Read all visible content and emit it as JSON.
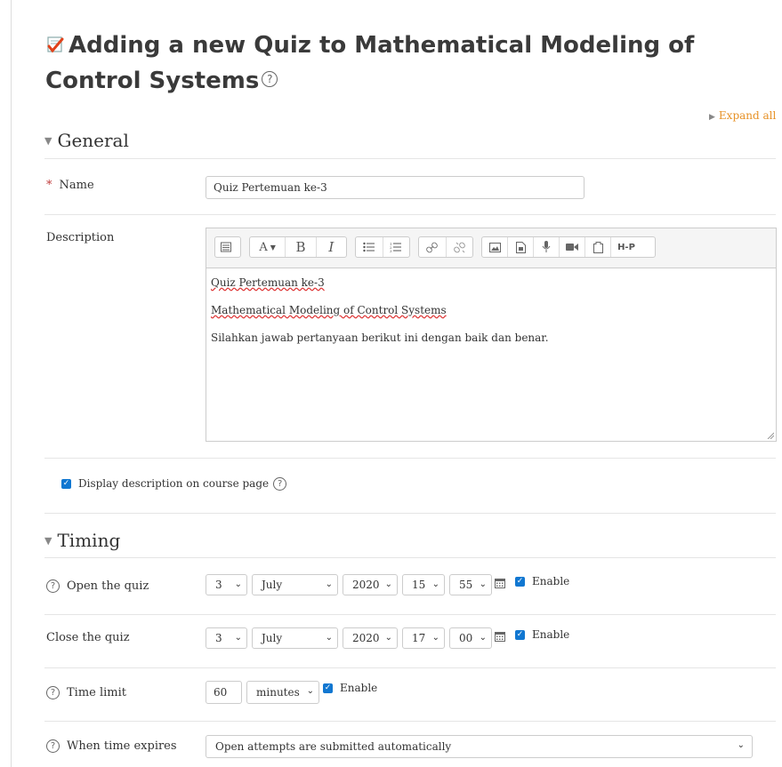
{
  "page": {
    "title": "Adding a new Quiz to Mathematical Modeling of Control Systems",
    "expand_all": "Expand all"
  },
  "general": {
    "legend": "General",
    "name_label": "Name",
    "name_value": "Quiz Pertemuan ke-3",
    "description_label": "Description",
    "editor_lines": [
      "Quiz Pertemuan ke-3",
      "Mathematical Modeling of Control Systems",
      "Silahkan jawab pertanyaan berikut ini dengan baik dan benar."
    ],
    "toolbar_icons": [
      "toolbar-toggle-icon",
      "font-style-icon",
      "bold-icon",
      "italic-icon",
      "unordered-list-icon",
      "ordered-list-icon",
      "link-icon",
      "unlink-icon",
      "image-icon",
      "media-icon",
      "record-audio-icon",
      "record-video-icon",
      "manage-files-icon",
      "h5p-icon"
    ],
    "toolbar_text": {
      "bold": "B",
      "italic": "I",
      "font": "A",
      "h5p": "H-P"
    },
    "display_description_label": "Display description on course page",
    "display_description_checked": true
  },
  "timing": {
    "legend": "Timing",
    "open": {
      "label": "Open the quiz",
      "day": "3",
      "month": "July",
      "year": "2020",
      "hour": "15",
      "minute": "55",
      "enable_label": "Enable",
      "enabled": true
    },
    "close": {
      "label": "Close the quiz",
      "day": "3",
      "month": "July",
      "year": "2020",
      "hour": "17",
      "minute": "00",
      "enable_label": "Enable",
      "enabled": true
    },
    "time_limit": {
      "label": "Time limit",
      "value": "60",
      "unit": "minutes",
      "enable_label": "Enable",
      "enabled": true
    },
    "when_expires": {
      "label": "When time expires",
      "value": "Open attempts are submitted automatically"
    }
  },
  "colors": {
    "accent": "#e79227",
    "checkbox": "#1177d1",
    "required": "#c13f3f"
  }
}
